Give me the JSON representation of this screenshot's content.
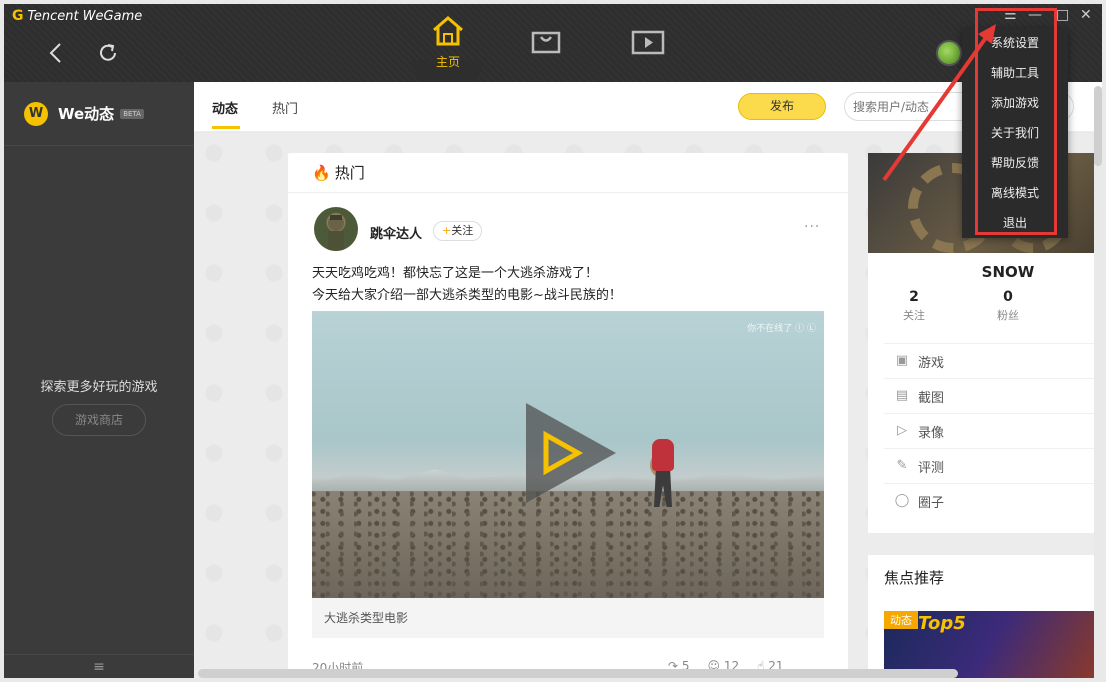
{
  "app": {
    "logo_text": "Tencent WeGame",
    "logo_mark": "G"
  },
  "topnav": {
    "home_label": "主页",
    "accent_color": "#f6c200"
  },
  "window_controls": {
    "menu": "☰",
    "minimize": "—",
    "maximize": "□",
    "close": "✕"
  },
  "sidebar": {
    "logo_mark": "W",
    "title": "We动态",
    "badge": "BETA",
    "explore_text": "探索更多好玩的游戏",
    "store_button": "游戏商店",
    "bottom_icon": "≡"
  },
  "content_tabs": [
    {
      "label": "动态",
      "active": true
    },
    {
      "label": "热门",
      "active": false
    }
  ],
  "publish_button": "发布",
  "search": {
    "placeholder": "搜索用户/动态"
  },
  "feed": {
    "header": "热门",
    "post": {
      "username": "跳伞达人",
      "follow_label": "关注",
      "more": "···",
      "text_line1": "天天吃鸡吃鸡！都快忘了这是一个大逃杀游戏了！",
      "text_line2": "今天给大家介绍一部大逃杀类型的电影~战斗民族的！",
      "video_watermark": "你不在线了 ⓛ Ⓛ",
      "video_caption": "大逃杀类型电影",
      "time": "20小时前",
      "shares": "5",
      "comments": "12",
      "likes": "21"
    }
  },
  "profile": {
    "name": "SNOW",
    "following_count": "2",
    "following_label": "关注",
    "fans_count": "0",
    "fans_label": "粉丝",
    "menu": [
      {
        "icon": "image-icon",
        "label": "游戏"
      },
      {
        "icon": "chart-icon",
        "label": "截图"
      },
      {
        "icon": "play-icon",
        "label": "录像"
      },
      {
        "icon": "edit-icon",
        "label": "评测"
      },
      {
        "icon": "circle-icon",
        "label": "圈子"
      }
    ]
  },
  "focus": {
    "title": "焦点推荐",
    "badge": "动态",
    "image_text": "Top5"
  },
  "dropdown_menu": [
    "系统设置",
    "辅助工具",
    "添加游戏",
    "关于我们",
    "帮助反馈",
    "离线模式",
    "退出"
  ],
  "annotation_color": "#e53935"
}
